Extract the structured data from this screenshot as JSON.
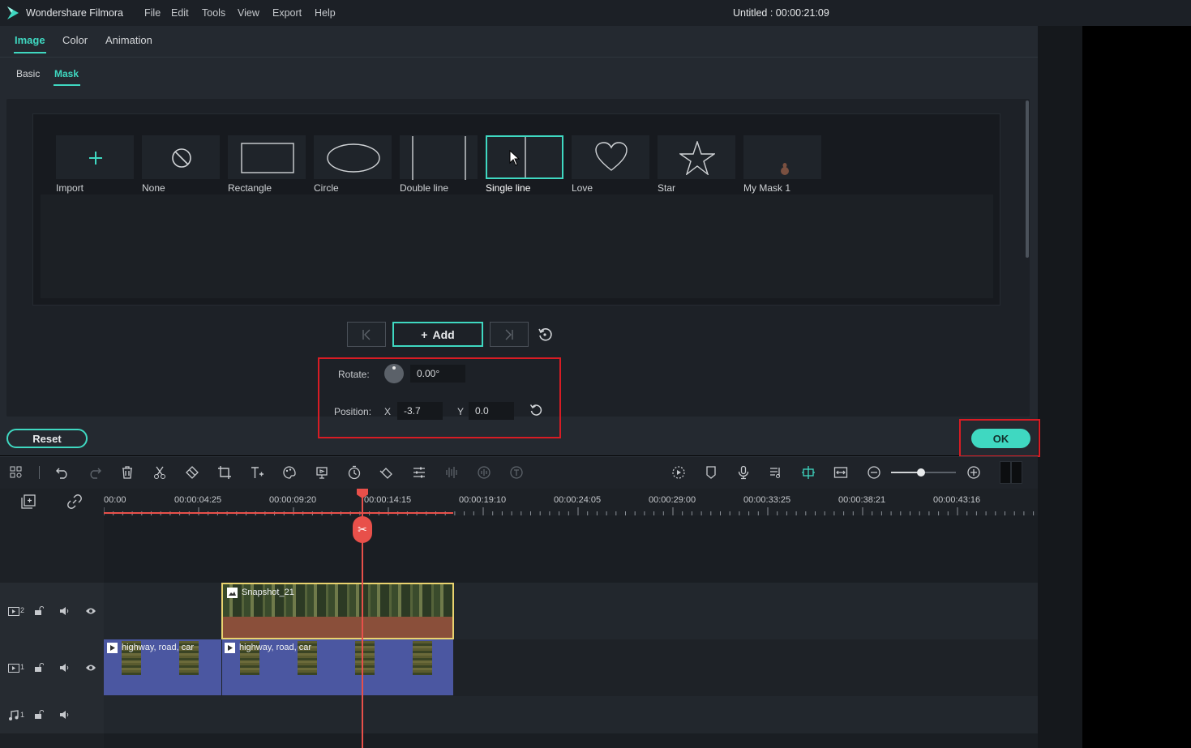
{
  "app": {
    "name": "Wondershare Filmora",
    "title": "Untitled : 00:00:21:09",
    "menu": [
      "File",
      "Edit",
      "Tools",
      "View",
      "Export",
      "Help"
    ]
  },
  "tabs": [
    "Image",
    "Color",
    "Animation"
  ],
  "subtabs": [
    "Basic",
    "Mask"
  ],
  "masks": [
    {
      "label": "Import",
      "icon": "plus-icon"
    },
    {
      "label": "None",
      "icon": "none-icon"
    },
    {
      "label": "Rectangle",
      "icon": "rectangle-icon"
    },
    {
      "label": "Circle",
      "icon": "ellipse-icon"
    },
    {
      "label": "Double line",
      "icon": "double-line-icon"
    },
    {
      "label": "Single line",
      "icon": "single-line-icon",
      "selected": true
    },
    {
      "label": "Love",
      "icon": "heart-icon"
    },
    {
      "label": "Star",
      "icon": "star-icon"
    },
    {
      "label": "My Mask 1",
      "icon": "custom-mask-thumbnail"
    }
  ],
  "keyframe": {
    "add_label": "Add"
  },
  "props": {
    "rotate_label": "Rotate:",
    "rotate_value": "0.00°",
    "position_label": "Position:",
    "x_label": "X",
    "x_value": "-3.7",
    "y_label": "Y",
    "y_value": "0.0"
  },
  "buttons": {
    "reset": "Reset",
    "ok": "OK"
  },
  "timeline": {
    "ruler": [
      "00:00",
      "00:00:04:25",
      "00:00:09:20",
      "00:00:14:15",
      "00:00:19:10",
      "00:00:24:05",
      "00:00:29:00",
      "00:00:33:25",
      "00:00:38:21",
      "00:00:43:16"
    ],
    "tracks": [
      {
        "id": "video-2",
        "label": "2"
      },
      {
        "id": "video-1",
        "label": "1"
      },
      {
        "id": "audio-1",
        "label": "1"
      }
    ],
    "clips": {
      "snapshot": "Snapshot_21",
      "video_a": "highway, road, car",
      "video_b": "highway, road, car"
    }
  },
  "colors": {
    "accent": "#3fd8c1",
    "highlight": "#d81c24",
    "playhead": "#e8504a",
    "selected_clip_border": "#e9d36f"
  }
}
